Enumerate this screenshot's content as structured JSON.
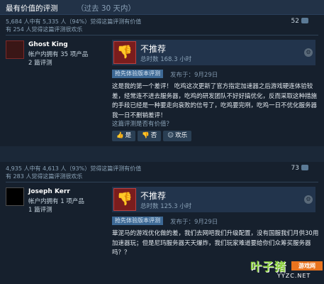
{
  "header": {
    "title": "最有价值的评测",
    "subtitle": "（过去 30 天内）"
  },
  "reviews": [
    {
      "helpful_line1": "5,684 人中有 5,335 人（94%）觉得这篇评测有价值",
      "helpful_line2": "有 254 人觉得这篇评测很欢乐",
      "reply_count": "52",
      "username": "Ghost King",
      "products": "帐户内拥有 35 项产品",
      "review_count": "2 篇评测",
      "verdict": "不推荐",
      "hours": "总时数 168.3 小时",
      "pill": "抢先体验版本评测",
      "posted": "发布于：9月29日",
      "text": "这是我的第一个差评！ 吃鸡这次更新了官方指定加速器之后游戏硬连体验较差，经常连不进去服务器，吃鸡的研发团队不好好搞优化，反而采取这种措施的手段已经是一种要走向衰败的信号了，吃鸡要完咧，吃鸡一日不优化服务器我一日不删销差评！",
      "question": "这篇评测是否有价值？",
      "yes": "是",
      "no": "否",
      "funny": "欢乐"
    },
    {
      "helpful_line1": "4,935 人中有 4,613 人（93%）觉得这篇评测有价值",
      "helpful_line2": "有 283 人觉得这篇评测很欢乐",
      "reply_count": "73",
      "username": "Joseph Kerr",
      "products": "帐户内拥有 1 项产品",
      "review_count": "1 篇评测",
      "verdict": "不推荐",
      "hours": "总时数 125.3 小时",
      "pill": "抢先体验版本评测",
      "posted": "发布于：9月29日",
      "text": "華泥马的游戏优化做的差，我们去网吧我们升级配置，没有国服我们月供30用加速器玩；但是尼玛服务器天天爆炸，我们玩家难道要给你们众筹买服务器吗？？"
    }
  ],
  "watermark": {
    "brand": "叶子猪",
    "tag": "游戏网",
    "domain": "YYZC.NET"
  },
  "colors": {
    "background": "#1b2838",
    "panel": "#16202d",
    "accent": "#3d6995",
    "negative": "#7a1d1d"
  }
}
